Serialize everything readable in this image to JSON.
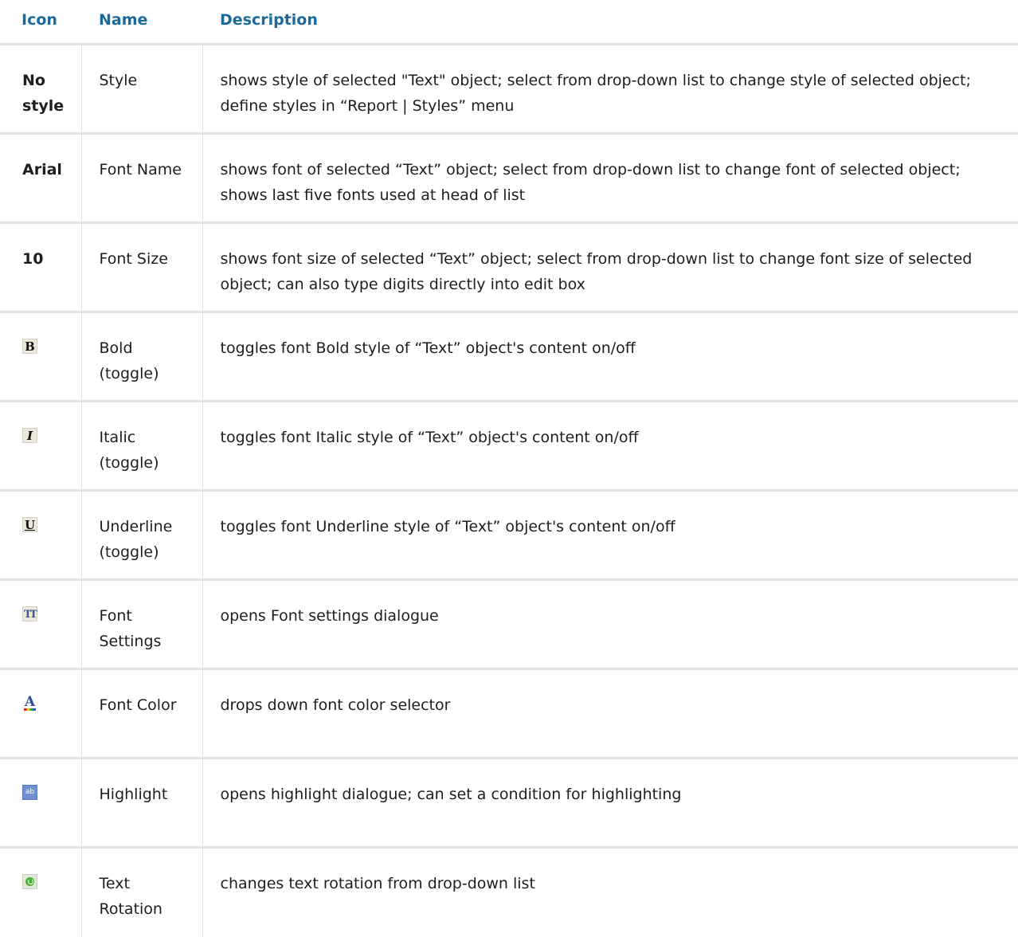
{
  "header": {
    "icon": "Icon",
    "name": "Name",
    "description": "Description"
  },
  "rows": [
    {
      "icon_text": "No style",
      "name": "Style",
      "description": "shows style of selected \"Text\" object; select from drop-down list to change style of selected object; define styles in “Report | Styles” menu"
    },
    {
      "icon_text": "Arial",
      "name": "Font Name",
      "description": "shows font of selected “Text” object; select from drop-down list to change font of selected object; shows last five fonts used at head of list"
    },
    {
      "icon_text": "10",
      "name": "Font Size",
      "description": "shows font size of selected “Text” object; select from drop-down list to change font size of selected object; can also type digits directly into edit box"
    },
    {
      "icon": "bold-icon",
      "glyph": "B",
      "name": "Bold (toggle)",
      "description": "toggles font Bold style of “Text” object's content on/off"
    },
    {
      "icon": "italic-icon",
      "glyph": "I",
      "name": "Italic (toggle)",
      "description": "toggles font Italic style of “Text” object's content on/off"
    },
    {
      "icon": "underline-icon",
      "glyph": "U",
      "name": "Underline (toggle)",
      "description": "toggles font Underline style of “Text” object's content on/off"
    },
    {
      "icon": "font-settings-icon",
      "glyph": "TT",
      "name": "Font Settings",
      "description": "opens Font settings dialogue"
    },
    {
      "icon": "font-color-icon",
      "glyph": "A",
      "name": "Font Color",
      "description": "drops down font color selector"
    },
    {
      "icon": "highlight-icon",
      "glyph": "ab",
      "name": "Highlight",
      "description": "opens highlight dialogue; can set a condition for highlighting"
    },
    {
      "icon": "text-rotation-icon",
      "name": "Text Rotation",
      "description": "changes text rotation from drop-down list"
    }
  ],
  "colors": {
    "header_text": "#1a6a9e",
    "divider": "#e3e3e3",
    "body_text": "#1e1e1e"
  }
}
